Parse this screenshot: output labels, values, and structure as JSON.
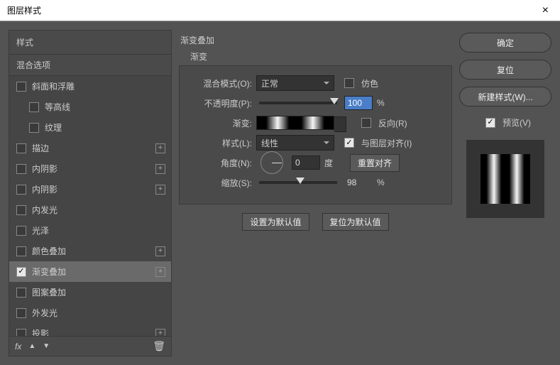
{
  "title": "图层样式",
  "close_glyph": "×",
  "styles": {
    "header": "样式",
    "blend_options": "混合选项",
    "items": [
      {
        "label": "斜面和浮雕",
        "checked": false,
        "plus": false,
        "indent": false
      },
      {
        "label": "等高线",
        "checked": false,
        "plus": false,
        "indent": true
      },
      {
        "label": "纹理",
        "checked": false,
        "plus": false,
        "indent": true
      },
      {
        "label": "描边",
        "checked": false,
        "plus": true,
        "indent": false
      },
      {
        "label": "内阴影",
        "checked": false,
        "plus": true,
        "indent": false
      },
      {
        "label": "内阴影",
        "checked": false,
        "plus": true,
        "indent": false
      },
      {
        "label": "内发光",
        "checked": false,
        "plus": false,
        "indent": false
      },
      {
        "label": "光泽",
        "checked": false,
        "plus": false,
        "indent": false
      },
      {
        "label": "颜色叠加",
        "checked": false,
        "plus": true,
        "indent": false
      },
      {
        "label": "渐变叠加",
        "checked": true,
        "plus": true,
        "indent": false,
        "selected": true
      },
      {
        "label": "图案叠加",
        "checked": false,
        "plus": false,
        "indent": false
      },
      {
        "label": "外发光",
        "checked": false,
        "plus": false,
        "indent": false
      },
      {
        "label": "投影",
        "checked": false,
        "plus": true,
        "indent": false
      }
    ],
    "footer_icons": {
      "fx": "fx",
      "up": "▲",
      "down": "▼",
      "trash": "🗑"
    }
  },
  "panel": {
    "title": "渐变叠加",
    "sub": "渐变",
    "blend_mode_label": "混合模式(O):",
    "blend_mode_value": "正常",
    "dither_label": "仿色",
    "opacity_label": "不透明度(P):",
    "opacity_value": "100",
    "percent": "%",
    "gradient_label": "渐变:",
    "reverse_label": "反向(R)",
    "style_label": "样式(L):",
    "style_value": "线性",
    "align_label": "与图层对齐(I)",
    "angle_label": "角度(N):",
    "angle_value": "0",
    "angle_unit": "度",
    "reset_align": "重置对齐",
    "scale_label": "缩放(S):",
    "scale_value": "98",
    "set_default": "设置为默认值",
    "reset_default": "复位为默认值"
  },
  "right": {
    "ok": "确定",
    "cancel": "复位",
    "new_style": "新建样式(W)...",
    "preview": "预览(V)"
  }
}
